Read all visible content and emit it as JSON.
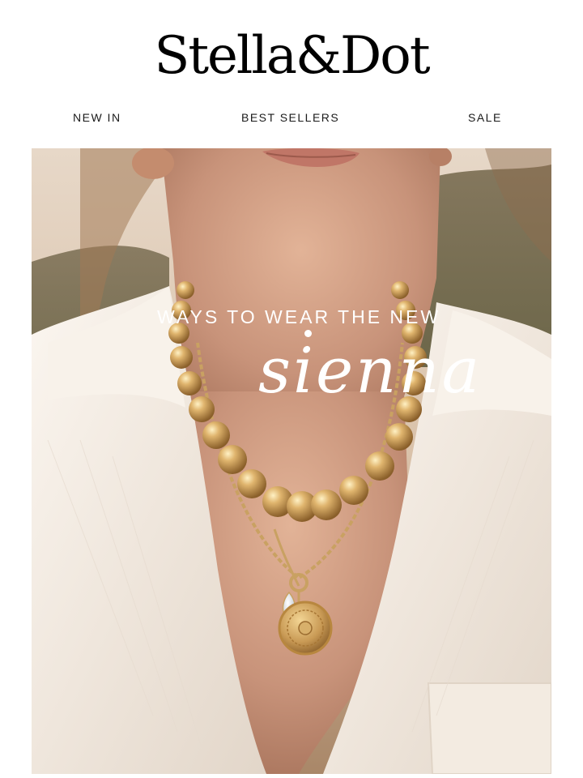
{
  "brand": {
    "logo_text": "Stella&Dot"
  },
  "nav": {
    "items": [
      {
        "label": "NEW IN"
      },
      {
        "label": "BEST SELLERS"
      },
      {
        "label": "SALE"
      }
    ]
  },
  "hero": {
    "kicker": "WAYS TO WEAR THE NEW",
    "script_title": "sienna"
  },
  "colors": {
    "background": "#ffffff",
    "text": "#111111",
    "hero_text": "#ffffff",
    "gold": "#c9a162",
    "shirt": "#f4efe9",
    "skin": "#c9987a"
  }
}
